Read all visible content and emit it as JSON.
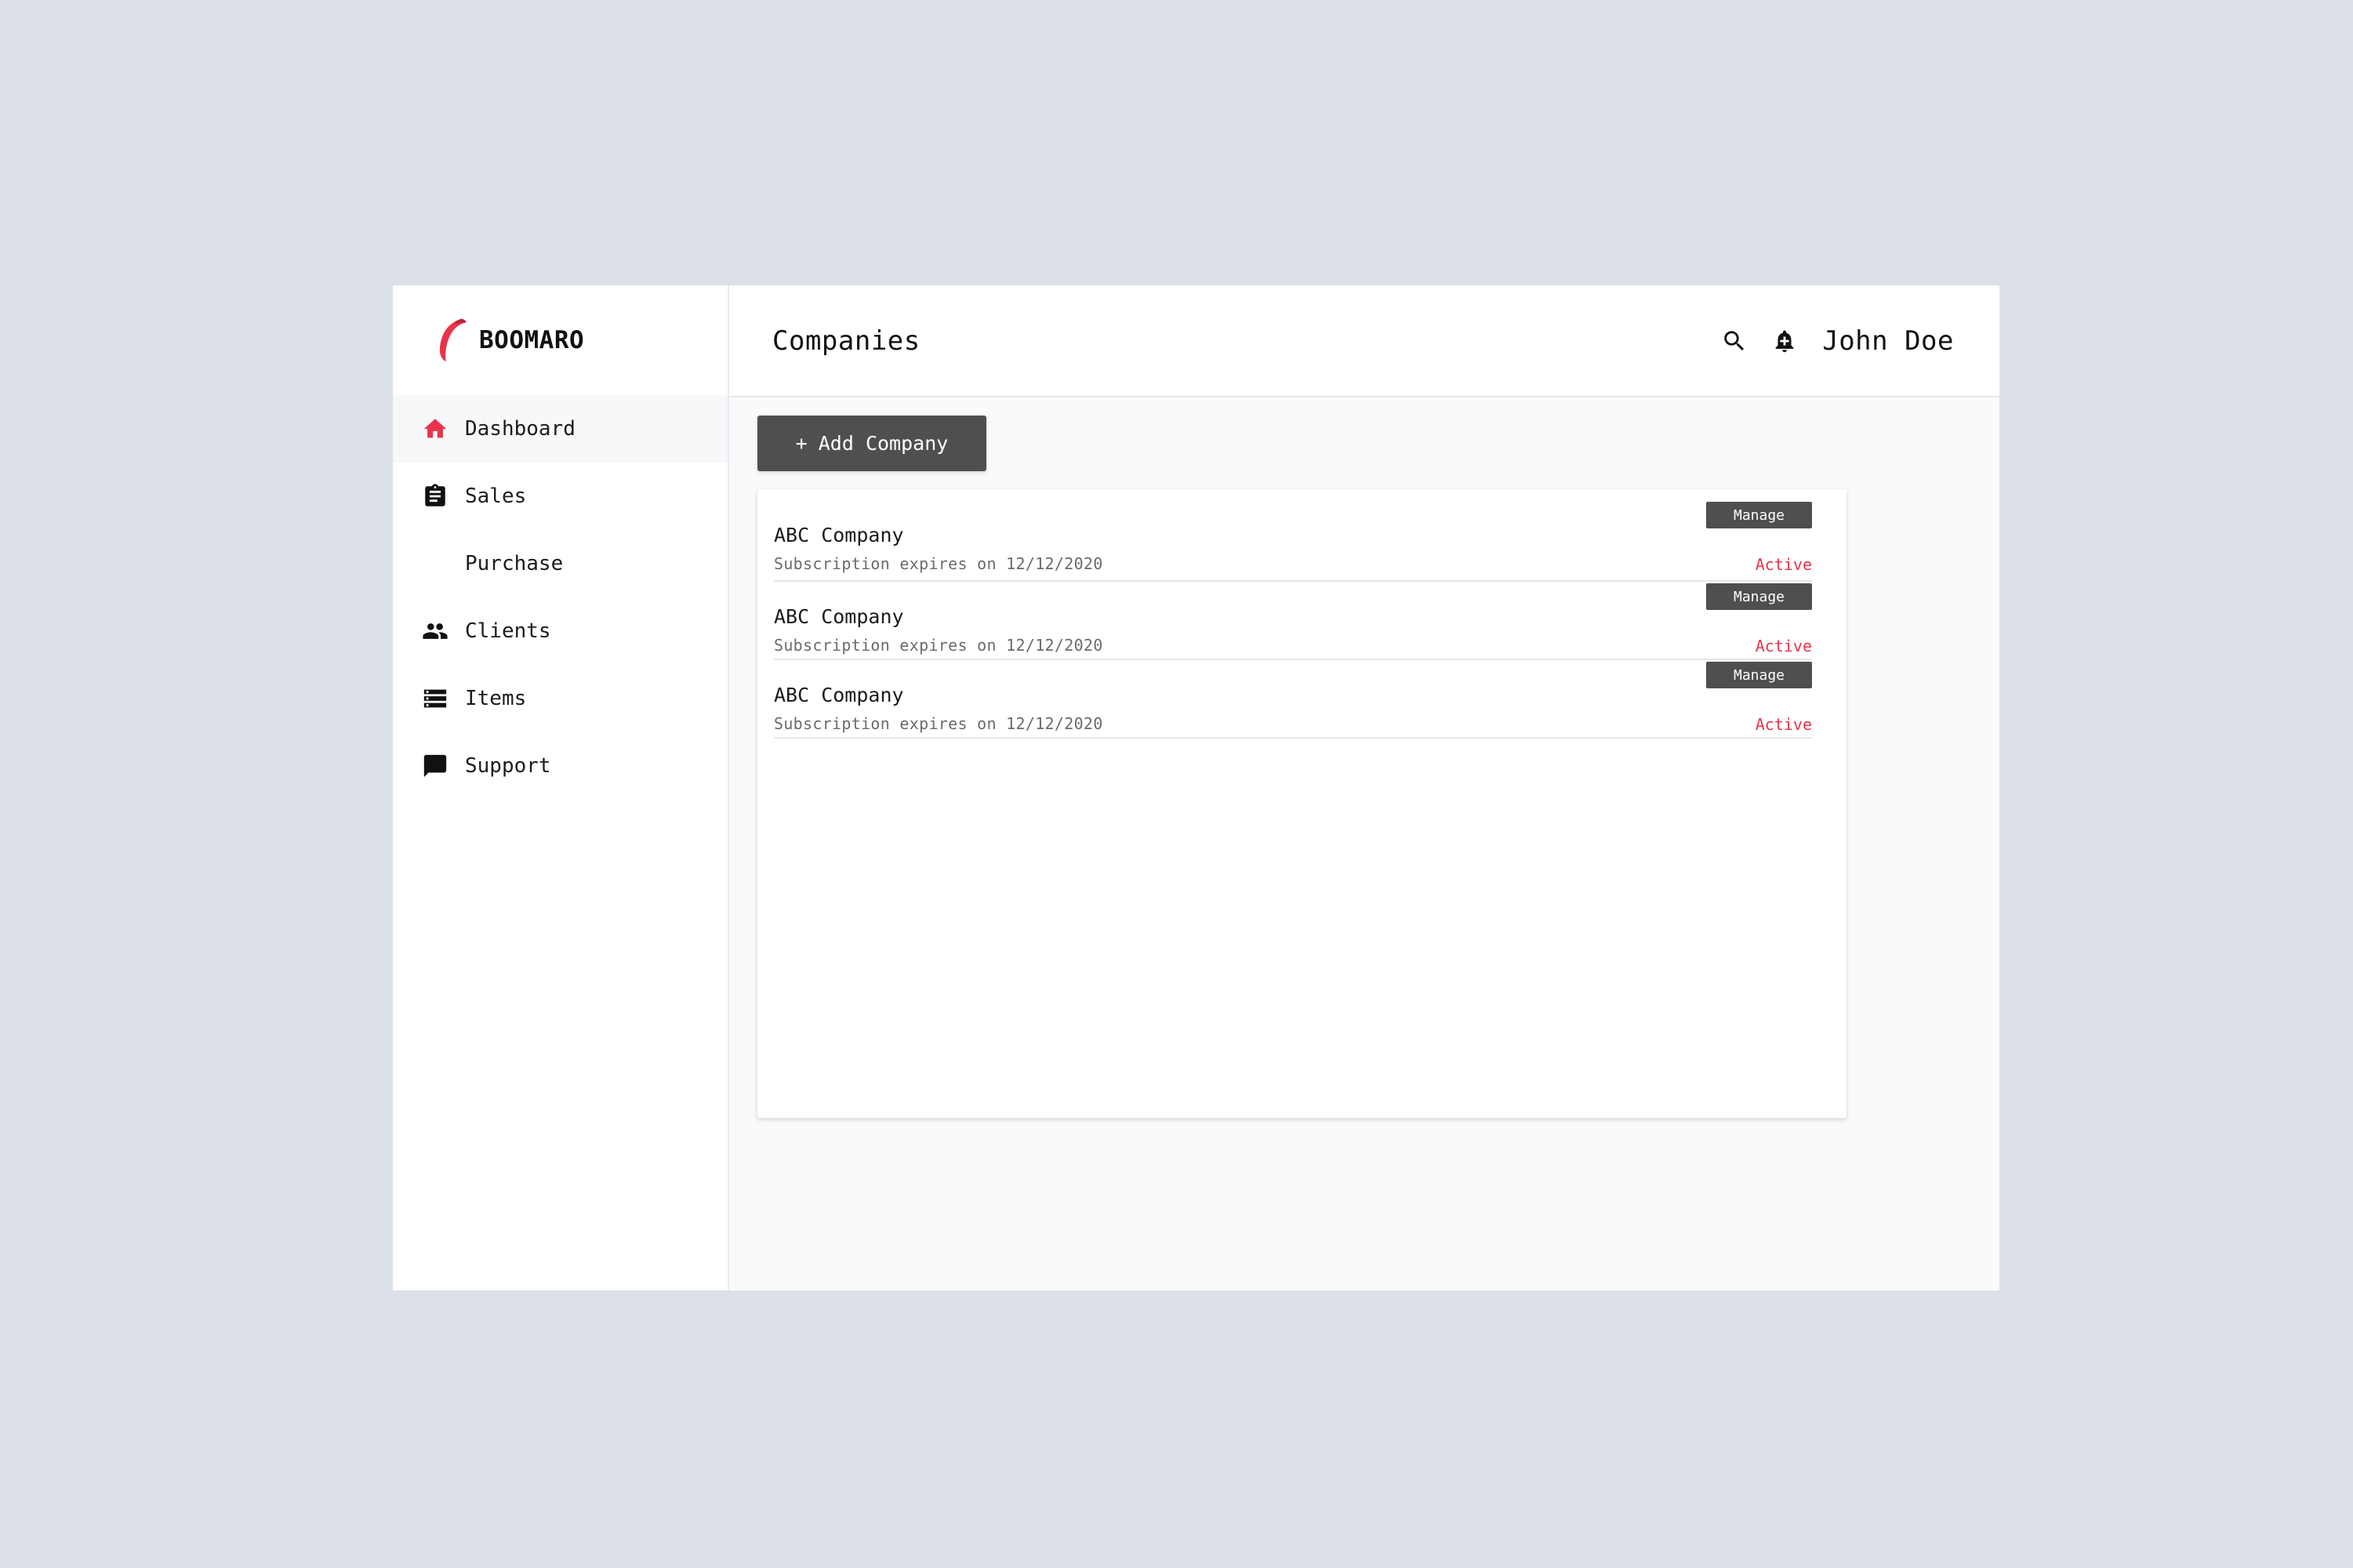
{
  "brand": {
    "name": "BOOMARO",
    "accent_color": "#e8344a"
  },
  "sidebar": {
    "items": [
      {
        "label": "Dashboard",
        "icon": "home-icon",
        "active": true
      },
      {
        "label": "Sales",
        "icon": "clipboard-icon"
      },
      {
        "label": "Purchase",
        "icon": ""
      },
      {
        "label": "Clients",
        "icon": "people-icon"
      },
      {
        "label": "Items",
        "icon": "storage-icon"
      },
      {
        "label": "Support",
        "icon": "chat-icon"
      }
    ]
  },
  "header": {
    "title": "Companies",
    "user_name": "John Doe",
    "icons": [
      "search-icon",
      "bell-icon"
    ]
  },
  "toolbar": {
    "add_label": "Add Company",
    "add_icon": "+"
  },
  "companies": [
    {
      "name": "ABC Company",
      "subtitle": "Subscription expires on 12/12/2020",
      "manage_label": "Manage",
      "status": "Active"
    },
    {
      "name": "ABC Company",
      "subtitle": "Subscription expires on 12/12/2020",
      "manage_label": "Manage",
      "status": "Active"
    },
    {
      "name": "ABC Company",
      "subtitle": "Subscription expires on 12/12/2020",
      "manage_label": "Manage",
      "status": "Active"
    }
  ]
}
